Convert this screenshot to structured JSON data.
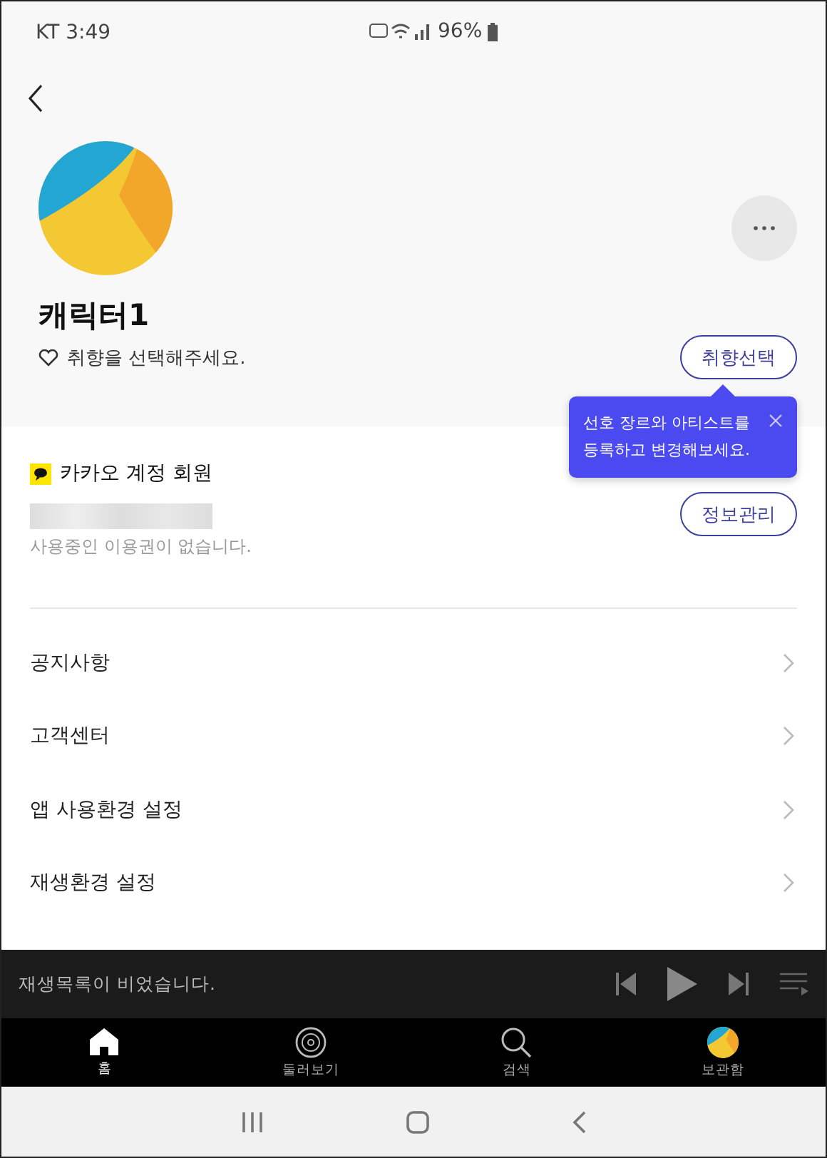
{
  "status_bar": {
    "carrier_time": "KT 3:49",
    "battery": "96%"
  },
  "profile": {
    "name": "캐릭터1",
    "taste_prompt": "취향을 선택해주세요.",
    "taste_button": "취향선택",
    "tooltip": "선호 장르와 아티스트를\n등록하고 변경해보세요."
  },
  "account": {
    "label": "카카오 계정 회원",
    "subscription": "사용중인 이용권이 없습니다.",
    "manage_button": "정보관리"
  },
  "menu": [
    {
      "label": "공지사항"
    },
    {
      "label": "고객센터"
    },
    {
      "label": "앱 사용환경 설정"
    },
    {
      "label": "재생환경 설정"
    }
  ],
  "player": {
    "message": "재생목록이 비었습니다."
  },
  "nav": [
    {
      "label": "홈",
      "kind": "home",
      "selected": true
    },
    {
      "label": "둘러보기",
      "kind": "disc",
      "selected": false
    },
    {
      "label": "검색",
      "kind": "search",
      "selected": false
    },
    {
      "label": "보관함",
      "kind": "avatar",
      "selected": false
    }
  ]
}
